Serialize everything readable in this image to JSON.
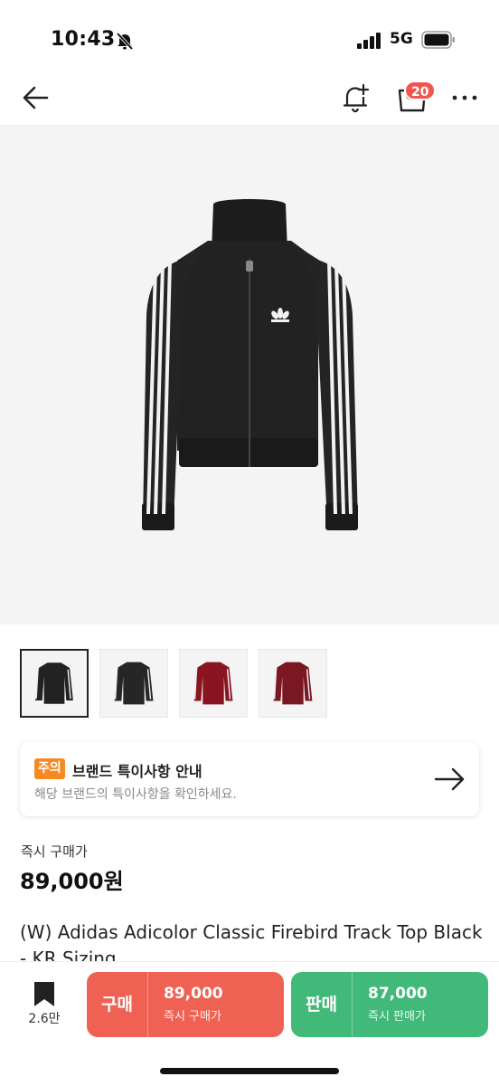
{
  "status_bar": {
    "time": "10:43",
    "network": "5G",
    "icons": [
      "bell-slash-icon",
      "signal-icon",
      "battery-icon"
    ]
  },
  "nav": {
    "icons": [
      "back-arrow-icon",
      "alert-add-icon",
      "cart-icon",
      "more-icon"
    ],
    "cart_badge": "20",
    "badge_color": "#f2554f"
  },
  "gallery": {
    "thumbnail_colors": [
      "black",
      "black",
      "burgundy",
      "burgundy"
    ],
    "selected_index": 0
  },
  "notice": {
    "tag": "주의",
    "title": "브랜드 특이사항 안내",
    "description": "해당 브랜드의 특이사항을 확인하세요.",
    "tag_color": "#f58a23"
  },
  "price": {
    "label": "즉시 구매가",
    "value": "89,000원"
  },
  "product": {
    "title": "(W) Adidas Adicolor Classic Firebird Track Top Black - KR Sizing"
  },
  "bottom_bar": {
    "bookmark_count": "2.6만",
    "buy": {
      "label": "구매",
      "price": "89,000",
      "sub": "즉시 구매가",
      "color": "#ef6253"
    },
    "sell": {
      "label": "판매",
      "price": "87,000",
      "sub": "즉시 판매가",
      "color": "#41b979"
    }
  }
}
